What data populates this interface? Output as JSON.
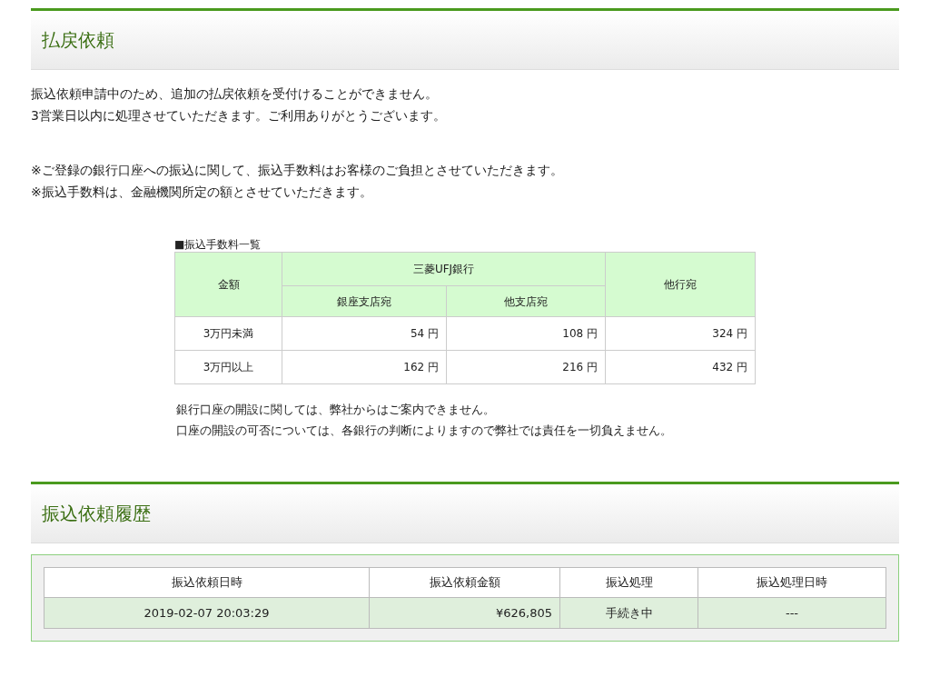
{
  "refund_section": {
    "title": "払戻依頼",
    "messages": [
      "振込依頼申請中のため、追加の払戻依頼を受付けることができません。",
      "3営業日以内に処理させていただきます。ご利用ありがとうございます。"
    ],
    "notes": [
      "※ご登録の銀行口座への振込に関して、振込手数料はお客様のご負担とさせていただきます。",
      "※振込手数料は、金融機関所定の額とさせていただきます。"
    ],
    "fee_table": {
      "caption": "■振込手数料一覧",
      "columns": {
        "amount": "金額",
        "bank": "三菱UFJ銀行",
        "same_bank_branch": "銀座支店宛",
        "other_branch": "他支店宛",
        "other_bank": "他行宛"
      },
      "rows": [
        {
          "amount": "3万円未満",
          "same_bank_branch": "54 円",
          "other_branch": "108 円",
          "other_bank": "324 円"
        },
        {
          "amount": "3万円以上",
          "same_bank_branch": "162 円",
          "other_branch": "216 円",
          "other_bank": "432 円"
        }
      ]
    },
    "footnotes": [
      "銀行口座の開設に関しては、弊社からはご案内できません。",
      "口座の開設の可否については、各銀行の判断によりますので弊社では責任を一切負えません。"
    ]
  },
  "history_section": {
    "title": "振込依頼履歴",
    "table": {
      "columns": [
        "振込依頼日時",
        "振込依頼金額",
        "振込処理",
        "振込処理日時"
      ],
      "rows": [
        [
          "2019-02-07 20:03:29",
          "¥626,805",
          "手続き中",
          "---"
        ]
      ]
    }
  }
}
